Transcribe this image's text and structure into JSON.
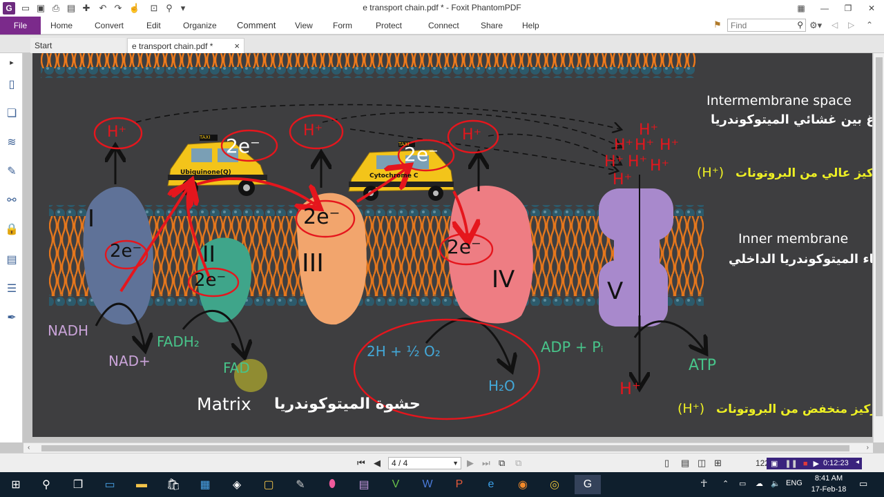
{
  "window": {
    "title": "e transport chain.pdf * - Foxit PhantomPDF",
    "app_icon_letter": "G"
  },
  "menu": {
    "file": "File",
    "items": [
      "Home",
      "Convert",
      "Edit",
      "Organize",
      "Comment",
      "View",
      "Form",
      "Protect",
      "Connect",
      "Share",
      "Help"
    ],
    "find_placeholder": "Find"
  },
  "tabs": {
    "start": "Start",
    "document": "e transport chain.pdf *",
    "close_glyph": "×"
  },
  "slide": {
    "intermembrane_en": "Intermembrane space",
    "intermembrane_ar": "الفراغ بين غشائي الميتوكوندريا",
    "high_conc_ar": "تركيز عالي من البروتونات",
    "high_conc_sym": "(H⁺)",
    "inner_membrane_en": "Inner membrane",
    "inner_membrane_ar": "غشاء الميتوكوندريا الداخلي",
    "low_conc_ar": "تركيز منخفض من البروتونات",
    "low_conc_sym": "(H⁺)",
    "matrix_en": "Matrix",
    "matrix_ar": "حشوة الميتوكوندريا",
    "complexes": [
      "I",
      "II",
      "III",
      "IV",
      "V"
    ],
    "electron_label": "2e⁻",
    "proton_label": "H⁺",
    "taxi1": "Ubiquinone(Q)",
    "taxi2": "Cytochrome C",
    "taxi_sign": "TAXI",
    "nadh": "NADH",
    "nad": "NAD+",
    "fadh2": "FADH₂",
    "fad": "FAD",
    "oxygen": "2H + ½ O₂",
    "water": "H₂O",
    "adp": "ADP + Pᵢ",
    "atp": "ATP"
  },
  "colors": {
    "slide_bg": "#3e3e40",
    "membrane_orange": "#ef7a1a",
    "membrane_head": "#2c5a6b",
    "complex_I": "#5f7298",
    "complex_II": "#3fa58a",
    "complex_III": "#f2a56d",
    "complex_IV": "#ee7d83",
    "complex_V": "#a889cc",
    "red": "#e5161d",
    "yellow_text": "#eef024",
    "lavender_text": "#c9a3d8",
    "green_text": "#48c48a",
    "blue_text": "#43a8d8"
  },
  "statusbar": {
    "page_indicator": "4 / 4",
    "zoom": "122.64%",
    "rec_time": "0:12:23"
  },
  "taskbar": {
    "clock_time": "8:41 AM",
    "clock_date": "17-Feb-18",
    "lang": "ENG"
  }
}
